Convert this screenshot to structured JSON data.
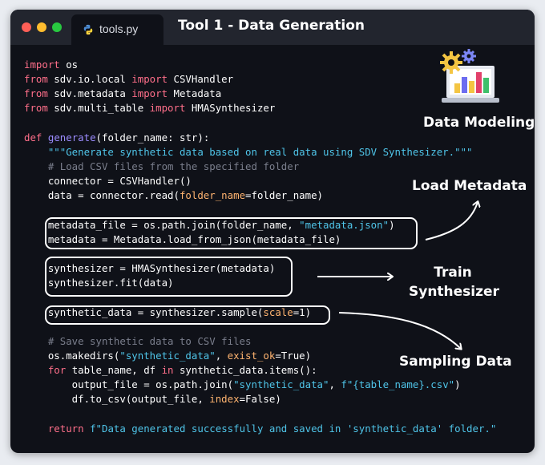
{
  "window": {
    "tab_label": "tools.py",
    "title": "Tool 1 - Data Generation"
  },
  "code": [
    {
      "row": 0,
      "tokens": [
        {
          "t": "import",
          "c": "kw"
        },
        {
          "t": " os",
          "c": ""
        }
      ]
    },
    {
      "row": 1,
      "tokens": [
        {
          "t": "from",
          "c": "kw"
        },
        {
          "t": " sdv.io.local ",
          "c": ""
        },
        {
          "t": "import",
          "c": "kw"
        },
        {
          "t": " CSVHandler",
          "c": ""
        }
      ]
    },
    {
      "row": 2,
      "tokens": [
        {
          "t": "from",
          "c": "kw"
        },
        {
          "t": " sdv.metadata ",
          "c": ""
        },
        {
          "t": "import",
          "c": "kw"
        },
        {
          "t": " Metadata",
          "c": ""
        }
      ]
    },
    {
      "row": 3,
      "tokens": [
        {
          "t": "from",
          "c": "kw"
        },
        {
          "t": " sdv.multi_table ",
          "c": ""
        },
        {
          "t": "import",
          "c": "kw"
        },
        {
          "t": " HMASynthesizer",
          "c": ""
        }
      ]
    },
    {
      "row": 5,
      "tokens": [
        {
          "t": "def",
          "c": "kw"
        },
        {
          "t": " ",
          "c": ""
        },
        {
          "t": "generate",
          "c": "fn"
        },
        {
          "t": "(folder_name: str):",
          "c": ""
        }
      ]
    },
    {
      "row": 6,
      "tokens": [
        {
          "t": "    \"\"\"Generate synthetic data based on real data using SDV Synthesizer.\"\"\"",
          "c": "str"
        }
      ]
    },
    {
      "row": 7,
      "tokens": [
        {
          "t": "    # Load CSV files from the specified folder",
          "c": "cm"
        }
      ]
    },
    {
      "row": 8,
      "tokens": [
        {
          "t": "    connector = CSVHandler()",
          "c": ""
        }
      ]
    },
    {
      "row": 9,
      "tokens": [
        {
          "t": "    data = connector.read(",
          "c": ""
        },
        {
          "t": "folder_name",
          "c": "prm"
        },
        {
          "t": "=folder_name)",
          "c": ""
        }
      ]
    },
    {
      "row": 11,
      "tokens": [
        {
          "t": "    metadata_file = os.path.join(folder_name, ",
          "c": ""
        },
        {
          "t": "\"metadata.json\"",
          "c": "str"
        },
        {
          "t": ")",
          "c": ""
        }
      ]
    },
    {
      "row": 12,
      "tokens": [
        {
          "t": "    metadata = Metadata.load_from_json(metadata_file)",
          "c": ""
        }
      ]
    },
    {
      "row": 14,
      "tokens": [
        {
          "t": "    synthesizer = HMASynthesizer(metadata)",
          "c": ""
        }
      ]
    },
    {
      "row": 15,
      "tokens": [
        {
          "t": "    synthesizer.fit(data)",
          "c": ""
        }
      ]
    },
    {
      "row": 17,
      "tokens": [
        {
          "t": "    synthetic_data = synthesizer.sample(",
          "c": ""
        },
        {
          "t": "scale",
          "c": "prm"
        },
        {
          "t": "=1)",
          "c": ""
        }
      ]
    },
    {
      "row": 19,
      "tokens": [
        {
          "t": "    # Save synthetic data to CSV files",
          "c": "cm"
        }
      ]
    },
    {
      "row": 20,
      "tokens": [
        {
          "t": "    os.makedirs(",
          "c": ""
        },
        {
          "t": "\"synthetic_data\"",
          "c": "str"
        },
        {
          "t": ", ",
          "c": ""
        },
        {
          "t": "exist_ok",
          "c": "prm"
        },
        {
          "t": "=True)",
          "c": ""
        }
      ]
    },
    {
      "row": 21,
      "tokens": [
        {
          "t": "    ",
          "c": ""
        },
        {
          "t": "for",
          "c": "kw"
        },
        {
          "t": " table_name, df ",
          "c": ""
        },
        {
          "t": "in",
          "c": "kw"
        },
        {
          "t": " synthetic_data.items():",
          "c": ""
        }
      ]
    },
    {
      "row": 22,
      "tokens": [
        {
          "t": "        output_file = os.path.join(",
          "c": ""
        },
        {
          "t": "\"synthetic_data\"",
          "c": "str"
        },
        {
          "t": ", ",
          "c": ""
        },
        {
          "t": "f\"{table_name}.csv\"",
          "c": "str"
        },
        {
          "t": ")",
          "c": ""
        }
      ]
    },
    {
      "row": 23,
      "tokens": [
        {
          "t": "        df.to_csv(output_file, ",
          "c": ""
        },
        {
          "t": "index",
          "c": "prm"
        },
        {
          "t": "=False)",
          "c": ""
        }
      ]
    },
    {
      "row": 25,
      "tokens": [
        {
          "t": "    ",
          "c": ""
        },
        {
          "t": "return",
          "c": "kw"
        },
        {
          "t": " ",
          "c": ""
        },
        {
          "t": "f\"Data generated successfully and saved in 'synthetic_data' folder.\"",
          "c": "str"
        }
      ]
    }
  ],
  "annotations": {
    "data_modeling": "Data Modeling",
    "load_metadata": "Load Metadata",
    "train_line1": "Train",
    "train_line2": "Synthesizer",
    "sampling_data": "Sampling Data"
  },
  "icons": {
    "tab": "python-logo-icon",
    "modeling": "gears-and-bar-chart-monitor-icon"
  },
  "colors": {
    "keyword": "#ff6f8a",
    "function": "#9c8cff",
    "string": "#4fc4e8",
    "comment": "#7a7e8c",
    "param": "#ffb470",
    "background": "#0f1118",
    "titlebar": "#22252e"
  }
}
